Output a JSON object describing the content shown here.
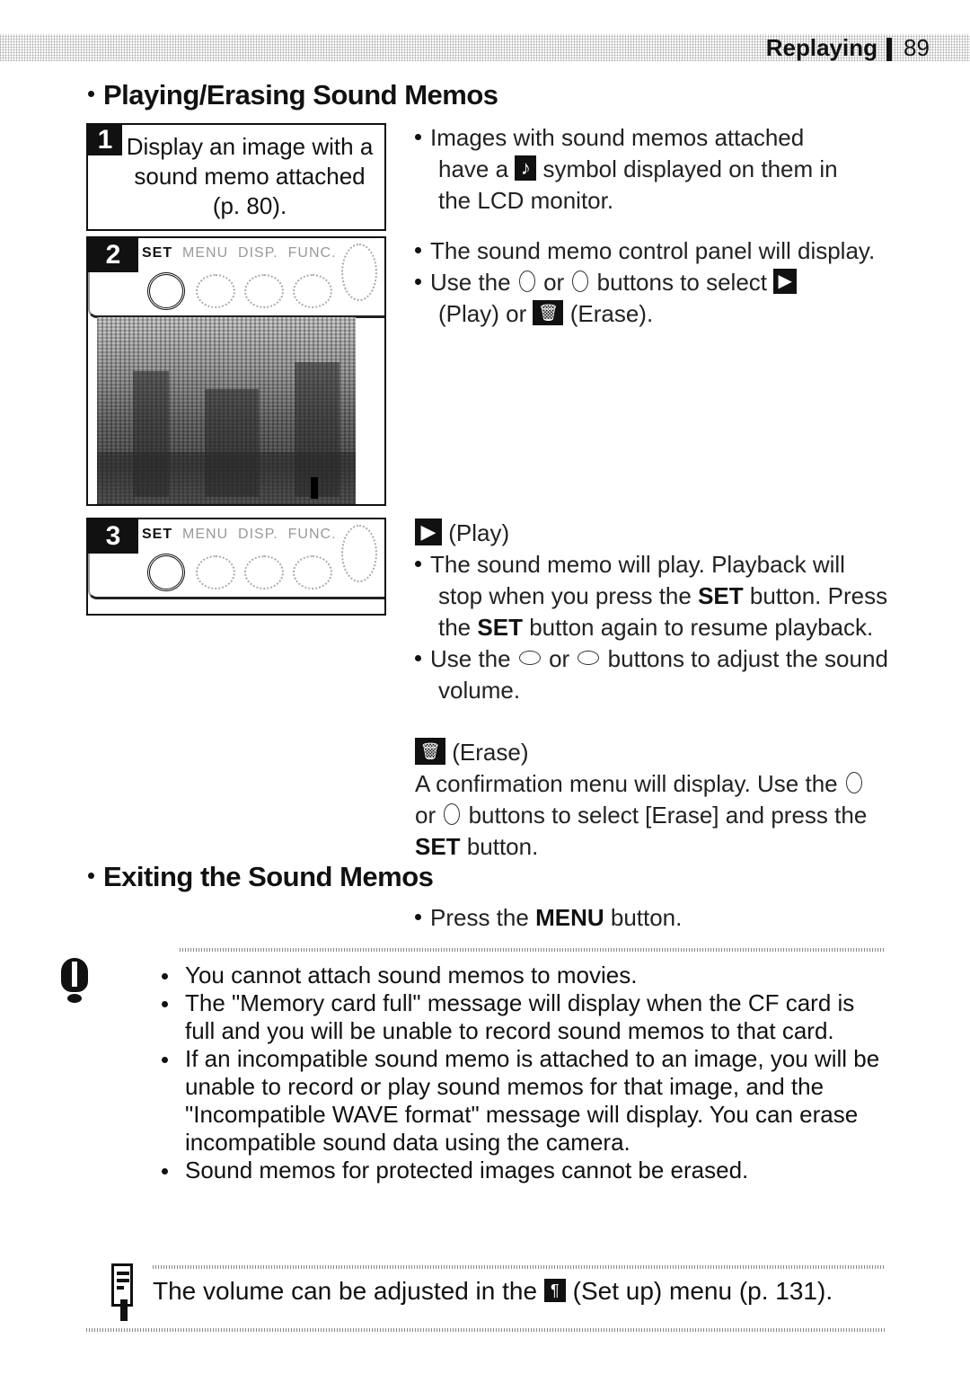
{
  "header": {
    "section": "Replaying",
    "page_number": "89"
  },
  "section1": {
    "title": "Playing/Erasing Sound Memos",
    "steps": [
      {
        "number": "1",
        "text": "Display an image with a sound memo attached (p. 80)."
      },
      {
        "number": "2",
        "panel_labels": [
          "SET",
          "MENU",
          "DISP.",
          "FUNC."
        ]
      },
      {
        "number": "3",
        "panel_labels": [
          "SET",
          "MENU",
          "DISP.",
          "FUNC."
        ]
      }
    ],
    "step1_notes": {
      "line1": "Images with sound memos attached",
      "line2_pre": "have a",
      "icon": "sound-memo-icon",
      "icon_glyph": "♪",
      "line2_post": "symbol displayed on them in",
      "line3": "the LCD monitor."
    },
    "step2_notes": {
      "bullet1": "The sound memo control panel will display.",
      "bullet2_pre": "Use the",
      "bullet2_mid1": "or",
      "bullet2_mid2": "buttons to select",
      "play_glyph": "▶",
      "bullet2_play": "(Play) or",
      "erase_glyph": "🗑",
      "bullet2_erase": "(Erase)."
    },
    "play": {
      "heading": "(Play)",
      "bullet1_a": "The sound memo will play. Playback will stop when you press the",
      "set": "SET",
      "bullet1_b": "button. Press the",
      "bullet1_c": "button again to resume playback.",
      "bullet2_pre": "Use the",
      "bullet2_or": "or",
      "bullet2_post": "buttons to adjust the sound volume."
    },
    "erase": {
      "heading": "(Erase)",
      "text_a": "A confirmation menu will display. Use the",
      "text_or": "or",
      "text_b": "buttons to select [Erase] and press the",
      "set": "SET",
      "text_c": "button."
    }
  },
  "section2": {
    "title": "Exiting the Sound Memos",
    "bullet_pre": "Press the",
    "menu": "MENU",
    "bullet_post": "button."
  },
  "caution": {
    "icon": "caution-icon",
    "items": [
      "You cannot attach sound memos to movies.",
      "The \"Memory card full\" message will display when the CF card is full and you will be unable to record sound memos to that card.",
      "If an incompatible sound memo is attached to an image, you will be unable to record or play sound memos for that image, and the \"Incompatible WAVE format\" message will display. You can erase incompatible sound data using the camera.",
      "Sound memos for protected images cannot be erased."
    ]
  },
  "memo_note": {
    "text_pre": "The volume can be adjusted in the",
    "icon": "setup-menu-icon",
    "text_post": "(Set up) menu (p. 131)."
  }
}
